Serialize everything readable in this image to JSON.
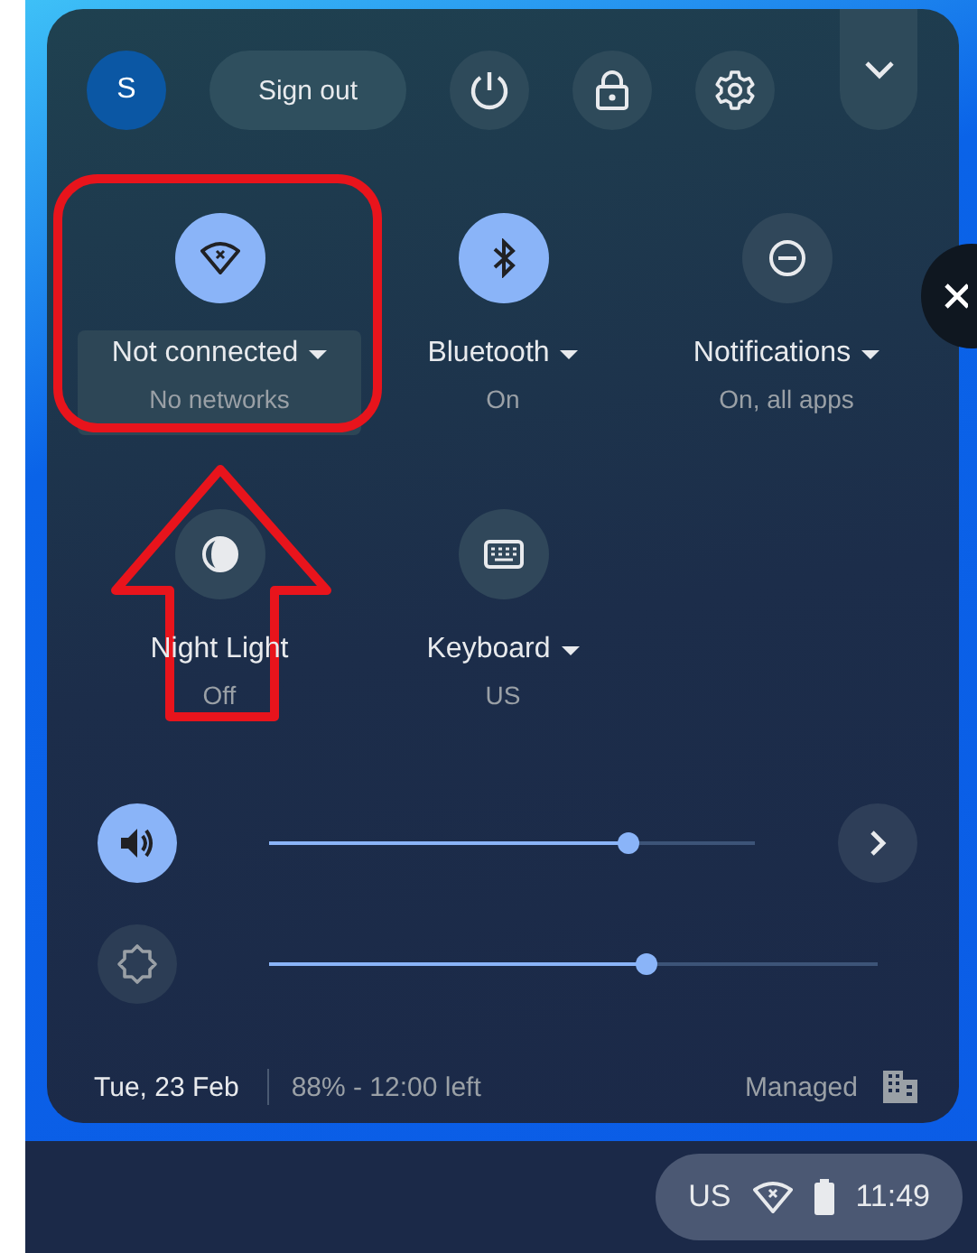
{
  "header": {
    "avatar": "S",
    "sign_out": "Sign out"
  },
  "tiles": [
    {
      "kind": "wifi",
      "label": "Not connected",
      "sublabel": "No networks",
      "on": true,
      "dropdown": true,
      "highlighted": true
    },
    {
      "kind": "bluetooth",
      "label": "Bluetooth",
      "sublabel": "On",
      "on": true,
      "dropdown": true,
      "highlighted": false
    },
    {
      "kind": "notifications",
      "label": "Notifications",
      "sublabel": "On, all apps",
      "on": false,
      "dropdown": true,
      "highlighted": false
    },
    {
      "kind": "night-light",
      "label": "Night Light",
      "sublabel": "Off",
      "on": false,
      "dropdown": false,
      "highlighted": false
    },
    {
      "kind": "keyboard",
      "label": "Keyboard",
      "sublabel": "US",
      "on": false,
      "dropdown": true,
      "highlighted": false
    }
  ],
  "sliders": [
    {
      "kind": "volume",
      "on": true,
      "level": 0.74
    },
    {
      "kind": "brightness",
      "on": false,
      "level": 0.62
    }
  ],
  "footer": {
    "date": "Tue, 23 Feb",
    "battery": "88% - 12:00 left",
    "managed": "Managed"
  },
  "shelf": {
    "ime": "US",
    "time": "11:49"
  }
}
